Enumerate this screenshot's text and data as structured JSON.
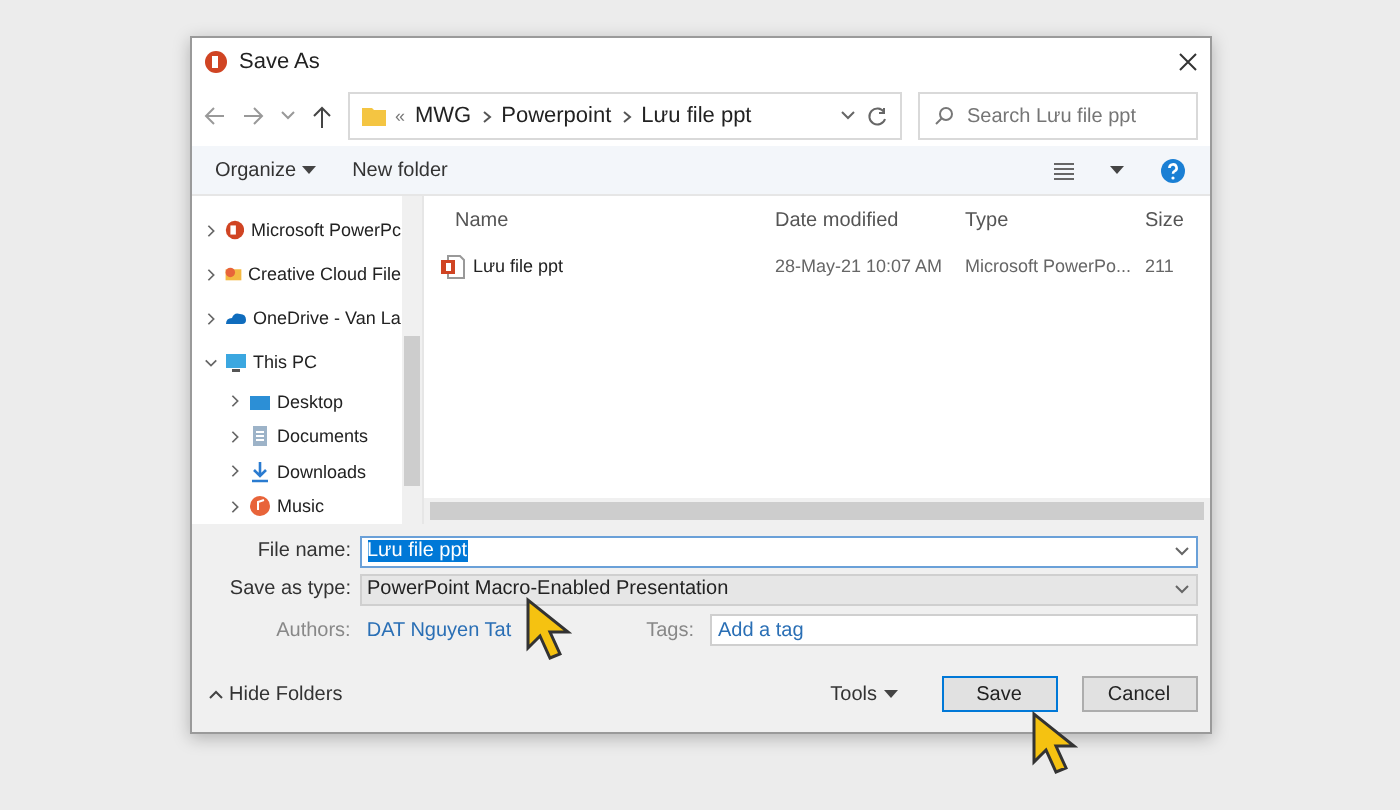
{
  "window": {
    "title": "Save As"
  },
  "nav": {
    "overflow": "«",
    "path": [
      "MWG",
      "Powerpoint",
      "Lưu file ppt"
    ],
    "search": {
      "placeholder": "Search Lưu file ppt"
    }
  },
  "toolbar": {
    "organize": "Organize",
    "new_folder": "New folder"
  },
  "sidebar": {
    "items": [
      {
        "label": "Microsoft PowerPc",
        "kind": "powerpoint",
        "expanded": false
      },
      {
        "label": "Creative Cloud File",
        "kind": "cloudfiles",
        "expanded": false
      },
      {
        "label": "OneDrive - Van La",
        "kind": "onedrive",
        "expanded": false
      },
      {
        "label": "This PC",
        "kind": "pc",
        "expanded": true,
        "children": [
          {
            "label": "Desktop",
            "kind": "desktop",
            "expanded": false
          },
          {
            "label": "Documents",
            "kind": "documents",
            "expanded": false
          },
          {
            "label": "Downloads",
            "kind": "downloads",
            "expanded": false
          },
          {
            "label": "Music",
            "kind": "music",
            "expanded": false
          }
        ]
      }
    ]
  },
  "table": {
    "columns": [
      "Name",
      "Date modified",
      "Type",
      "Size"
    ],
    "rows": [
      {
        "name": "Lưu file ppt",
        "date": "28-May-21 10:07 AM",
        "type": "Microsoft PowerPo...",
        "size": "211"
      }
    ]
  },
  "form": {
    "file_name": {
      "label": "File name:",
      "value": "Lưu file ppt",
      "selected": true
    },
    "save_type": {
      "label": "Save as type:",
      "value": "PowerPoint Macro-Enabled Presentation"
    },
    "authors": {
      "label": "Authors:",
      "value": "DAT Nguyen Tat"
    },
    "tags": {
      "label": "Tags:",
      "placeholder": "Add a tag"
    }
  },
  "footer": {
    "hide_folders": "Hide Folders",
    "tools": "Tools",
    "save": "Save",
    "cancel": "Cancel"
  }
}
